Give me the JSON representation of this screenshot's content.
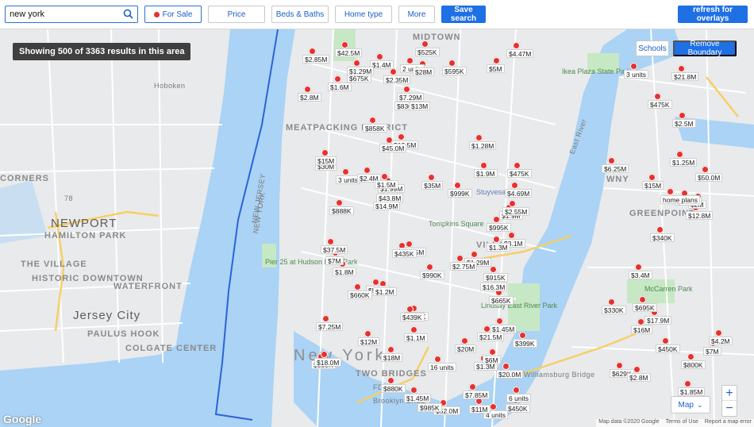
{
  "toolbar": {
    "search_value": "new york",
    "filters": [
      "For Sale",
      "Price",
      "Beds & Baths",
      "Home type",
      "More"
    ],
    "save_search": "Save search",
    "refresh": "refresh for overlays"
  },
  "map": {
    "results_banner": "Showing 500 of 3363 results in this area",
    "schools_btn": "Schools",
    "remove_boundary_btn": "Remove Boundary",
    "map_type": "Map",
    "zoom_in": "+",
    "zoom_out": "−",
    "attribution": [
      "Map data ©2020 Google",
      "Terms of Use",
      "Report a map error"
    ],
    "google_logo": "Google",
    "places": [
      "MIDTOWN",
      "MEATPACKING DISTRICT",
      "GREENPOINT",
      "HAMILTON PARK",
      "NEWPORT",
      "THE VILLAGE",
      "HISTORIC DOWNTOWN",
      "WATERFRONT",
      "Jersey City",
      "PAULUS HOOK",
      "COLGATE CENTER",
      "New York",
      "TWO BRIDGES",
      "Hoboken",
      "CORNERS",
      "WNY",
      "VILLAGE",
      "Pier 25 at Hudson River Park",
      "Lindsay East River Park",
      "McCarren Park",
      "Williamsburg Bridge",
      "FDR Dr",
      "NEW JERSEY",
      "NEW YORK",
      "East River",
      "Brooklyn Bridge",
      "Stuyvesant Town",
      "Tompkins Square",
      "Ikea Plaza State Park",
      "495",
      "78"
    ],
    "colors": {
      "water": "#aad3f5",
      "land": "#e9eaec",
      "park": "#c7e8c4",
      "pin": "#e8312e",
      "primary": "#1f6fe5"
    }
  },
  "listings": [
    "$1.29M",
    "$800K",
    "$18M",
    "$16.3M",
    "3 units",
    "2 units",
    "$1.3M",
    "$12M",
    "$450K",
    "$1.9M",
    "$2.4M",
    "$7.25M",
    "$17.9M",
    "$15M",
    "$330K",
    "16 units",
    "6 units",
    "3 units",
    "$2.5M",
    "$888K",
    "4 units",
    "$6M",
    "$675K",
    "$330K",
    "$830K",
    "$7.29M",
    "$629K",
    "$999K",
    "$18.0M",
    "$12.5M",
    "$21.5M",
    "$14.9M",
    "$30M",
    "$37.5M",
    "$13M",
    "$45.0M",
    "$11M",
    "$50.0M",
    "$35M",
    "$6.25M",
    "$28M",
    "$20.0M",
    "$16M",
    "$1.45M",
    "$21.8M",
    "$2.75M",
    "$7M",
    "$2.85M",
    "$475K",
    "$450K",
    "$858K",
    "$995K",
    "$599K",
    "$20M",
    "$42.5M",
    "$12.8M",
    "$525K",
    "$52.0M",
    "$15M",
    "$2.8M",
    "$8.75M",
    "$990K",
    "$43.8M",
    "$4.47M",
    "$435K",
    "$5M",
    "$1.2M",
    "$4.69M",
    "$2M",
    "$665K",
    "$1.99M",
    "$3.4M",
    "$1.9M",
    "$4.2M",
    "$7.85M",
    "$880K",
    "$7M",
    "$695K",
    "$915K",
    "$500K",
    "$1.4M",
    "$439K",
    "$399K",
    "$475K",
    "$340K",
    "$1.25M",
    "$1.1M",
    "$1.6M",
    "$1.35M",
    "$1.8M",
    "$1.85M",
    "$1.5M",
    "$1.29M",
    "$2.35M",
    "$3.1M",
    "$2.55M",
    "$1.45M",
    "$595K",
    "$985K",
    "$660K",
    "$1.28M",
    "$2.8M",
    "$1.3M",
    "home plans"
  ]
}
